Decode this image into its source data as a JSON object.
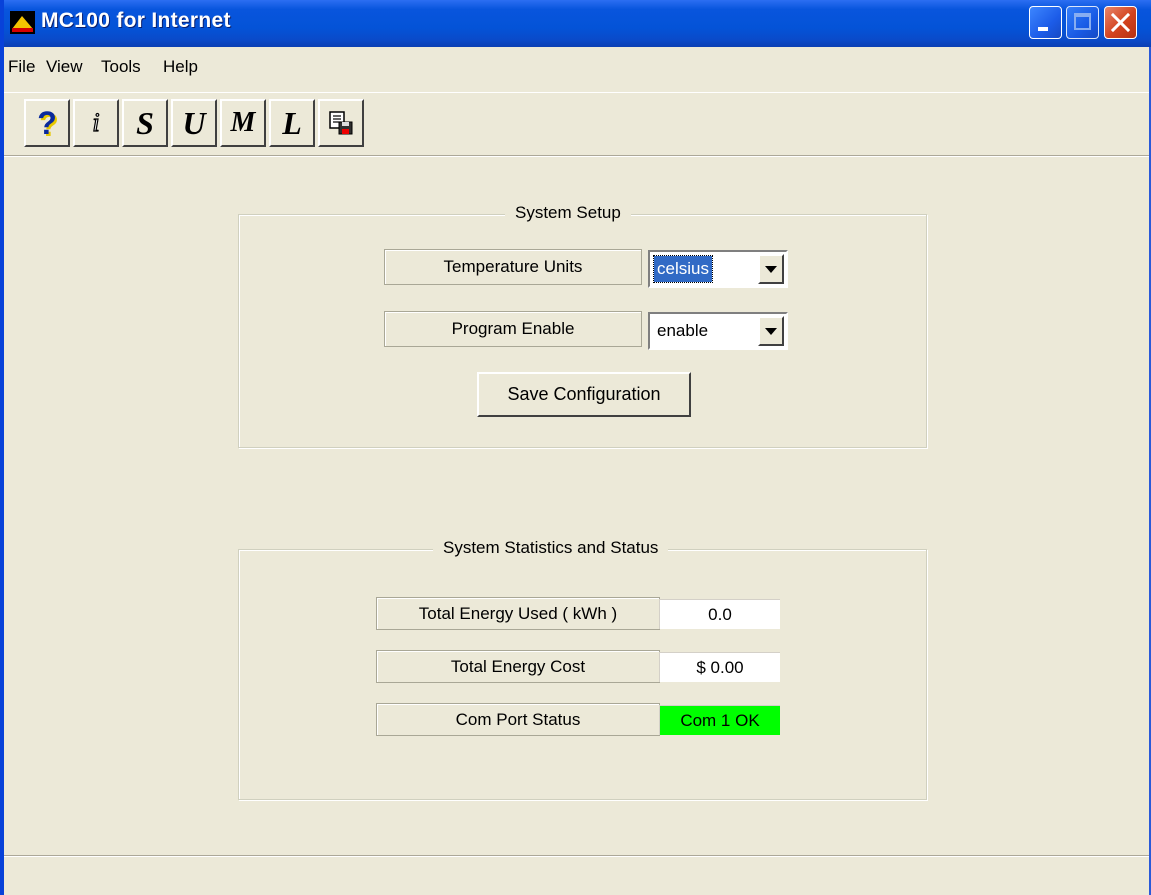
{
  "window": {
    "title": "MC100 for Internet"
  },
  "menu": {
    "items": [
      "File",
      "View",
      "Tools",
      "Help"
    ]
  },
  "toolbar": {
    "buttons": [
      {
        "glyph": "?",
        "icon": "help-icon"
      },
      {
        "glyph": "i",
        "icon": "info-icon"
      },
      {
        "glyph": "S",
        "icon": "s-letter-icon"
      },
      {
        "glyph": "U",
        "icon": "u-letter-icon"
      },
      {
        "glyph": "M",
        "icon": "m-letter-icon"
      },
      {
        "glyph": "L",
        "icon": "l-letter-icon"
      },
      {
        "glyph": "",
        "icon": "save-document-icon"
      }
    ]
  },
  "system_setup": {
    "title": "System Setup",
    "temperature_units": {
      "label": "Temperature Units",
      "value": "celsius"
    },
    "program_enable": {
      "label": "Program Enable",
      "value": "enable"
    },
    "save_label": "Save Configuration"
  },
  "system_status": {
    "title": "System Statistics and Status",
    "total_energy_used": {
      "label": "Total Energy Used ( kWh )",
      "value": "0.0"
    },
    "total_energy_cost": {
      "label": "Total Energy Cost",
      "value": "$ 0.00"
    },
    "com_port_status": {
      "label": "Com Port Status",
      "value": "Com 1 OK",
      "color": "#00ff00"
    }
  },
  "colors": {
    "titlebar": "#0453d7",
    "face": "#ece9d8",
    "selection": "#316ac5",
    "status_ok": "#00ff00"
  }
}
